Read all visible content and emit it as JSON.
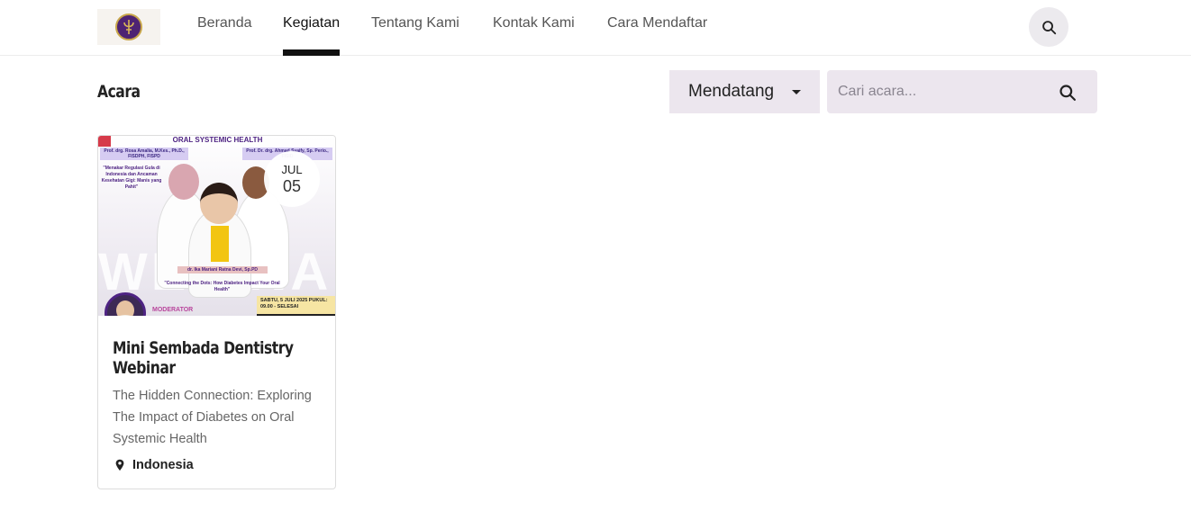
{
  "header": {
    "logo_alt": "logo",
    "nav": [
      {
        "label": "Beranda",
        "active": false
      },
      {
        "label": "Kegiatan",
        "active": true
      },
      {
        "label": "Tentang Kami",
        "active": false
      },
      {
        "label": "Kontak Kami",
        "active": false
      },
      {
        "label": "Cara Mendaftar",
        "active": false
      }
    ],
    "search_icon": "search-icon"
  },
  "toolbar": {
    "title": "Acara",
    "filter_label": "Mendatang",
    "search_placeholder": "Cari acara...",
    "search_icon": "search-icon"
  },
  "events": [
    {
      "date_month": "JUL",
      "date_day": "05",
      "title": "Mini Sembada Dentistry Webinar",
      "description": "The Hidden Connection: Exploring The Impact of Diabetes on Oral Systemic Health",
      "location": "Indonesia",
      "location_icon": "map-pin-icon",
      "poster": {
        "banner": "ORAL SYSTEMIC HEALTH",
        "speaker_1": "Prof. drg. Rosa Amalia, M.Kes., Ph.D., FISDPH, FISPD",
        "speaker_1_quote": "\"Menakar Regulasi Gula di Indonesia dan Ancaman Kesehatan Gigi: Manis yang Pahit\"",
        "speaker_2": "Prof. Dr. drg. Ahmad Syaify, Sp. Perio., FISID",
        "speaker_3": "dr. Ika Mariani Ratna Devi, Sp.PD",
        "speaker_3_quote": "\"Connecting the Dots: How Diabetes Impact Your Oral Health\"",
        "watermark": "WEBINAR",
        "schedule": "SABTU, 5 JULI 2025 PUKUL: 09.00 - SELESAI",
        "moderator_label": "MODERATOR"
      }
    }
  ],
  "colors": {
    "accent": "#111111",
    "chip_bg": "#ece6ee",
    "brand_purple": "#4e2383"
  }
}
